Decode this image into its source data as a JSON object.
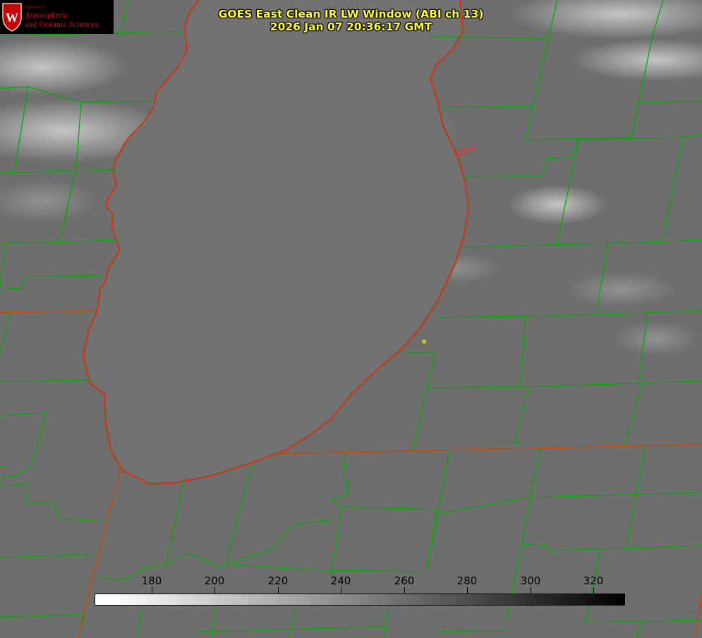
{
  "logo": {
    "line1": "Department of",
    "line2": "Atmospheric",
    "line3": "and Oceanic Sciences",
    "color": "#c5050c"
  },
  "title": {
    "line1": "GOES East Clean IR LW Window (ABI ch 13)",
    "line2": "2026 Jan 07 20:36:17 GMT",
    "color": "#ffff33"
  },
  "colorbar": {
    "range": [
      162,
      330
    ],
    "tick_labels": [
      "180",
      "200",
      "220",
      "240",
      "260",
      "280",
      "300",
      "320"
    ]
  },
  "map": {
    "lake_outline_color": "#ff2020",
    "boundary_color": "#00aa00",
    "state_line_color": "#cc4400",
    "marker_color": "#d7c21b"
  }
}
